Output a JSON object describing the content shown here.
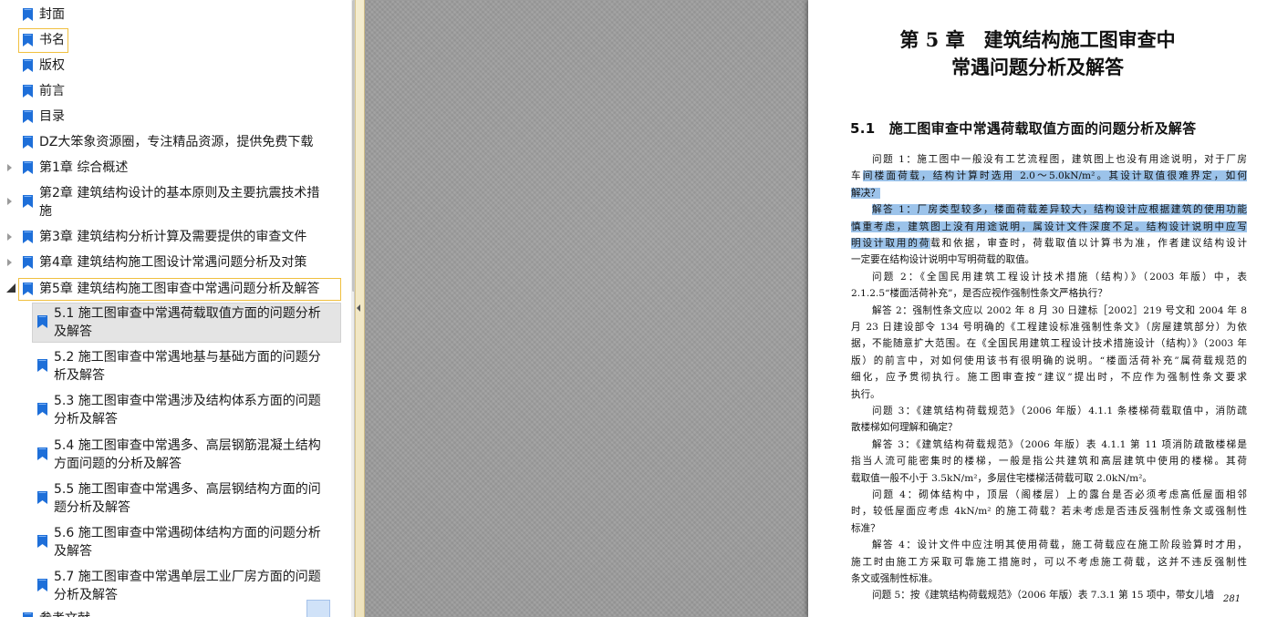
{
  "bookmarks": [
    {
      "label": "封面"
    },
    {
      "label": "书名"
    },
    {
      "label": "版权"
    },
    {
      "label": "前言"
    },
    {
      "label": "目录"
    },
    {
      "label": "DZ大笨象资源圈，专注精品资源，提供免费下载"
    },
    {
      "label": "第1章 综合概述"
    },
    {
      "label": "第2章 建筑结构设计的基本原则及主要抗震技术措",
      "label2": "施"
    },
    {
      "label": "第3章 建筑结构分析计算及需要提供的审查文件"
    },
    {
      "label": "第4章 建筑结构施工图设计常遇问题分析及对策"
    },
    {
      "label": "第5章 建筑结构施工图审查中常遇问题分析及解答"
    },
    {
      "label": "5.1 施工图审查中常遇荷载取值方面的问题分析",
      "label2": "及解答"
    },
    {
      "label": "5.2 施工图审查中常遇地基与基础方面的问题分",
      "label2": "析及解答"
    },
    {
      "label": "5.3 施工图审查中常遇涉及结构体系方面的问题",
      "label2": "分析及解答"
    },
    {
      "label": "5.4 施工图审查中常遇多、高层钢筋混凝土结构",
      "label2": "方面问题的分析及解答"
    },
    {
      "label": "5.5 施工图审查中常遇多、高层钢结构方面的问",
      "label2": "题分析及解答"
    },
    {
      "label": "5.6 施工图审查中常遇砌体结构方面的问题分析",
      "label2": "及解答"
    },
    {
      "label": "5.7 施工图审查中常遇单层工业厂房方面的问题",
      "label2": "分析及解答"
    },
    {
      "label": "参考文献"
    }
  ],
  "document": {
    "chapter_title_line1": "第 5 章　建筑结构施工图审查中",
    "chapter_title_line2": "常遇问题分析及解答",
    "section_title": "5.1　施工图审查中常遇荷载取值方面的问题分析及解答",
    "lines": [
      {
        "pre": "问题 1：施工图中一般没有工艺流程图，建筑图上也没有用途说明，对于厂房",
        "hl": ""
      },
      {
        "pre": "车",
        "hl": "间楼面荷载，结构计算时选用 2.0～5.0kN/m²。其设计取值很难界定，如何"
      },
      {
        "pre": "",
        "hl": "解决？"
      },
      {
        "pre": "",
        "hl": "解答 1：厂房类型较多，楼面荷载差异较大，结构设计应根据建筑的使用功能"
      },
      {
        "pre": "",
        "hl": "慎重考虑，建筑图上没有用途说明，属设计文件深度不足。结构设计说明中应写"
      },
      {
        "pre": "",
        "hl": "明设计取用的荷",
        "post": "载和依据，审查时，荷载取值以计算书为准，作者建议结构设计"
      },
      {
        "pre": "一定要在结构设计说明中写明荷载的取值。",
        "hl": ""
      },
      {
        "pre": "问题 2：《全国民用建筑工程设计技术措施（结构）》（2003 年版）中，表",
        "hl": ""
      },
      {
        "pre": "2.1.2.5“楼面活荷补充”，是否应视作强制性条文严格执行？",
        "hl": ""
      },
      {
        "pre": "解答 2：强制性条文应以 2002 年 8 月 30 日建标［2002］219 号文和 2004 年 8",
        "hl": ""
      },
      {
        "pre": "月 23 日建设部令 134 号明确的《工程建设标准强制性条文》（房屋建筑部分）为依",
        "hl": ""
      },
      {
        "pre": "据，不能随意扩大范围。在《全国民用建筑工程设计技术措施设计（结构）》（2003 年",
        "hl": ""
      },
      {
        "pre": "版）的前言中，对如何使用该书有很明确的说明。“楼面活荷补充”属荷载规范的",
        "hl": ""
      },
      {
        "pre": "细化，应予贯彻执行。施工图审查按“建议”提出时，不应作为强制性条文要求",
        "hl": ""
      },
      {
        "pre": "执行。",
        "hl": ""
      },
      {
        "pre": "问题 3：《建筑结构荷载规范》（2006 年版）4.1.1 条楼梯荷载取值中，消防疏",
        "hl": ""
      },
      {
        "pre": "散楼梯如何理解和确定？",
        "hl": ""
      },
      {
        "pre": "解答 3：《建筑结构荷载规范》（2006 年版）表 4.1.1 第 11 项消防疏散楼梯是",
        "hl": ""
      },
      {
        "pre": "指当人流可能密集时的楼梯，一般是指公共建筑和高层建筑中使用的楼梯。其荷",
        "hl": ""
      },
      {
        "pre": "载取值一般不小于 3.5kN/m²，多层住宅楼梯活荷载可取 2.0kN/m²。",
        "hl": ""
      },
      {
        "pre": "问题 4：砌体结构中，顶层（阁楼层）上的露台是否必须考虑高低屋面相邻",
        "hl": ""
      },
      {
        "pre": "时，较低屋面应考虑 4kN/m² 的施工荷载？若未考虑是否违反强制性条文或强制性",
        "hl": ""
      },
      {
        "pre": "标准？",
        "hl": ""
      },
      {
        "pre": "解答 4：设计文件中应注明其使用荷载，施工荷载应在施工阶段验算时才用，",
        "hl": ""
      },
      {
        "pre": "施工时由施工方采取可靠施工措施时，可以不考虑施工荷载，这并不违反强制性",
        "hl": ""
      },
      {
        "pre": "条文或强制性标准。",
        "hl": ""
      },
      {
        "pre": "问题 5：按《建筑结构荷载规范》（2006 年版）表 7.3.1 第 15 项中，带女儿墙",
        "hl": ""
      }
    ],
    "page_number": "281"
  },
  "colors": {
    "highlight": "#9cc3ea",
    "bookmark_icon": "#1e6fd9",
    "selected_outline": "#f0c040"
  }
}
